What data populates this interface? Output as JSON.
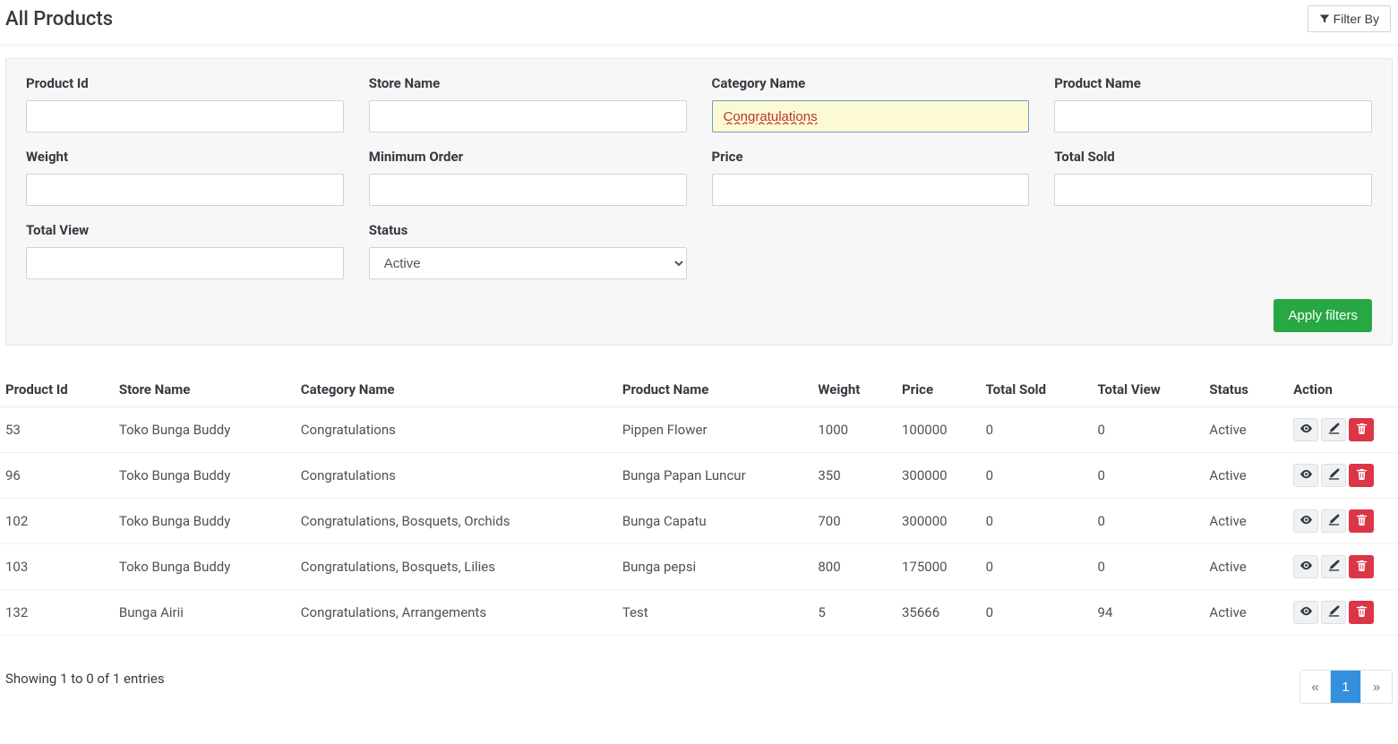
{
  "header": {
    "title": "All Products",
    "filter_by": "Filter By"
  },
  "filters": {
    "product_id": {
      "label": "Product Id",
      "value": ""
    },
    "store_name": {
      "label": "Store Name",
      "value": ""
    },
    "category_name": {
      "label": "Category Name",
      "value": "Congratulations"
    },
    "product_name": {
      "label": "Product Name",
      "value": ""
    },
    "weight": {
      "label": "Weight",
      "value": ""
    },
    "minimum_order": {
      "label": "Minimum Order",
      "value": ""
    },
    "price": {
      "label": "Price",
      "value": ""
    },
    "total_sold": {
      "label": "Total Sold",
      "value": ""
    },
    "total_view": {
      "label": "Total View",
      "value": ""
    },
    "status": {
      "label": "Status",
      "value": "Active"
    },
    "apply": "Apply filters"
  },
  "table": {
    "headers": {
      "product_id": "Product Id",
      "store_name": "Store Name",
      "category_name": "Category Name",
      "product_name": "Product Name",
      "weight": "Weight",
      "price": "Price",
      "total_sold": "Total Sold",
      "total_view": "Total View",
      "status": "Status",
      "action": "Action"
    },
    "rows": [
      {
        "product_id": "53",
        "store_name": "Toko Bunga Buddy",
        "category_name": "Congratulations",
        "product_name": "Pippen Flower",
        "weight": "1000",
        "price": "100000",
        "total_sold": "0",
        "total_view": "0",
        "status": "Active"
      },
      {
        "product_id": "96",
        "store_name": "Toko Bunga Buddy",
        "category_name": "Congratulations",
        "product_name": "Bunga Papan Luncur",
        "weight": "350",
        "price": "300000",
        "total_sold": "0",
        "total_view": "0",
        "status": "Active"
      },
      {
        "product_id": "102",
        "store_name": "Toko Bunga Buddy",
        "category_name": "Congratulations, Bosquets, Orchids",
        "product_name": "Bunga Capatu",
        "weight": "700",
        "price": "300000",
        "total_sold": "0",
        "total_view": "0",
        "status": "Active"
      },
      {
        "product_id": "103",
        "store_name": "Toko Bunga Buddy",
        "category_name": "Congratulations, Bosquets, Lilies",
        "product_name": "Bunga pepsi",
        "weight": "800",
        "price": "175000",
        "total_sold": "0",
        "total_view": "0",
        "status": "Active"
      },
      {
        "product_id": "132",
        "store_name": "Bunga Airii",
        "category_name": "Congratulations, Arrangements",
        "product_name": "Test",
        "weight": "5",
        "price": "35666",
        "total_sold": "0",
        "total_view": "94",
        "status": "Active"
      }
    ]
  },
  "footer": {
    "showing": "Showing 1 to 0 of 1 entries",
    "prev": "«",
    "page": "1",
    "next": "»"
  }
}
